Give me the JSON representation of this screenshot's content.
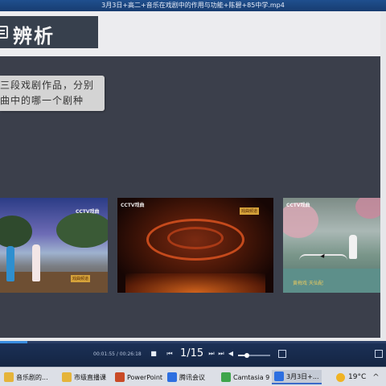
{
  "window": {
    "title": "3月3日+高二+音乐在戏剧中的作用与功能+陈碧+85中学.mp4"
  },
  "slide": {
    "header_title": "辨析",
    "question_lines": [
      "三段戏剧作品，分别",
      "曲中的哪一个剧种"
    ]
  },
  "clips": [
    {
      "logo": "CCTV戏曲",
      "badge": "戏曲频道"
    },
    {
      "logo": "CCTV戏曲",
      "badge": "戏曲频道"
    },
    {
      "logo": "CCTV戏曲",
      "caption": "黄梅戏 天仙配"
    }
  ],
  "player": {
    "time": "00:01:55 / 00:26:18",
    "page": "1/15",
    "progress_fraction": 0.07,
    "volume_fraction": 0.25,
    "icons": [
      "stop-icon",
      "prev-icon",
      "play-icon",
      "next-icon",
      "end-icon",
      "volume-icon"
    ]
  },
  "taskbar": {
    "items": [
      {
        "label": "音乐剧的...",
        "icon": "folder-icon",
        "color": "#e5b43a"
      },
      {
        "label": "市级直播课",
        "icon": "folder-icon",
        "color": "#e5b43a"
      },
      {
        "label": "PowerPoint",
        "icon": "powerpoint-icon",
        "color": "#c94a26"
      },
      {
        "label": "腾讯会议",
        "icon": "tencent-meeting-icon",
        "color": "#2d6fe0"
      },
      {
        "label": "Camtasia 9",
        "icon": "camtasia-icon",
        "color": "#3ea54b"
      },
      {
        "label": "3月3日+...",
        "icon": "video-player-icon",
        "color": "#2d6fe0"
      }
    ],
    "weather": "19°C"
  },
  "colors": {
    "slide_bg": "#3b3f4b",
    "header_box": "#37404d",
    "accent": "#3a8de0"
  }
}
